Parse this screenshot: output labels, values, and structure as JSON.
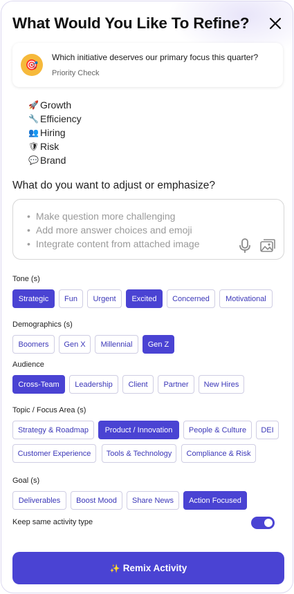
{
  "header": {
    "title": "What Would You Like To Refine?",
    "close_icon": "close-icon"
  },
  "question": {
    "text": "Which initiative deserves our primary focus this quarter?",
    "subtitle": "Priority Check",
    "icon": "target-icon",
    "icon_glyph": "🎯"
  },
  "answers": [
    {
      "emoji": "🚀",
      "label": "Growth"
    },
    {
      "emoji": "🔧",
      "label": "Efficiency"
    },
    {
      "emoji": "👥",
      "label": "Hiring"
    },
    {
      "emoji": "🛡",
      "label": "Risk"
    },
    {
      "emoji": "💬",
      "label": "Brand"
    }
  ],
  "adjust": {
    "label": "What do you want to adjust or emphasize?",
    "hints": [
      "Make question more challenging",
      "Add more answer choices and emoji",
      "Integrate content from attached image"
    ],
    "mic_icon": "microphone-icon",
    "image_icon": "image-icon"
  },
  "tone": {
    "label": "Tone (s)",
    "chips": [
      {
        "label": "Strategic",
        "selected": true
      },
      {
        "label": "Fun",
        "selected": false
      },
      {
        "label": "Urgent",
        "selected": false
      },
      {
        "label": "Excited",
        "selected": true
      },
      {
        "label": "Concerned",
        "selected": false
      },
      {
        "label": "Motivational",
        "selected": false
      }
    ]
  },
  "demographics": {
    "label": "Demographics (s)",
    "chips": [
      {
        "label": "Boomers",
        "selected": false
      },
      {
        "label": "Gen X",
        "selected": false
      },
      {
        "label": "Millennial",
        "selected": false
      },
      {
        "label": "Gen Z",
        "selected": true
      }
    ]
  },
  "audience": {
    "label": "Audience",
    "chips": [
      {
        "label": "Cross-Team",
        "selected": true
      },
      {
        "label": "Leadership",
        "selected": false
      },
      {
        "label": "Client",
        "selected": false
      },
      {
        "label": "Partner",
        "selected": false
      },
      {
        "label": "New Hires",
        "selected": false
      }
    ]
  },
  "topic": {
    "label": "Topic / Focus Area (s)",
    "chips": [
      {
        "label": "Strategy & Roadmap",
        "selected": false
      },
      {
        "label": "Product / Innovation",
        "selected": true
      },
      {
        "label": "People & Culture",
        "selected": false
      },
      {
        "label": "DEI",
        "selected": false
      },
      {
        "label": "Customer Experience",
        "selected": false
      },
      {
        "label": "Tools & Technology",
        "selected": false
      },
      {
        "label": "Compliance & Risk",
        "selected": false
      }
    ]
  },
  "goal": {
    "label": "Goal (s)",
    "chips": [
      {
        "label": "Deliverables",
        "selected": false
      },
      {
        "label": "Boost Mood",
        "selected": false
      },
      {
        "label": "Share News",
        "selected": false
      },
      {
        "label": "Action Focused",
        "selected": true
      }
    ]
  },
  "keep_same": {
    "label": "Keep same activity type",
    "enabled": true
  },
  "remix": {
    "icon": "sparkles-icon",
    "icon_glyph": "✨",
    "label": "Remix Activity"
  },
  "colors": {
    "accent": "#4a43d3",
    "chip_text": "#3b37b8",
    "chip_border": "#cfcde3",
    "icon_bg": "#f6b93b"
  }
}
